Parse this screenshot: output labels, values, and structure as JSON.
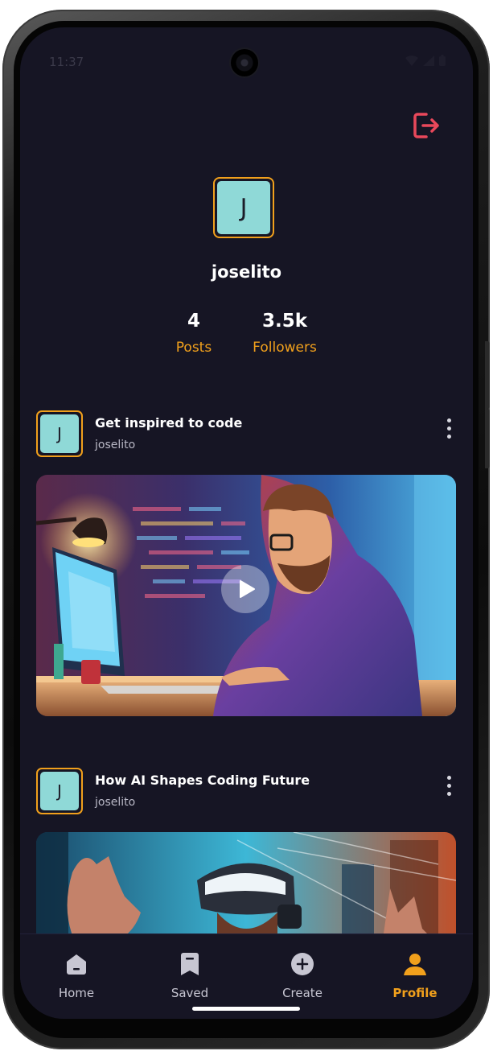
{
  "status": {
    "time": "11:37"
  },
  "profile": {
    "avatar_letter": "J",
    "username": "joselito",
    "stats": [
      {
        "value": "4",
        "label": "Posts"
      },
      {
        "value": "3.5k",
        "label": "Followers"
      }
    ]
  },
  "posts": [
    {
      "avatar_letter": "J",
      "title": "Get inspired to code",
      "author": "joselito",
      "media": "video"
    },
    {
      "avatar_letter": "J",
      "title": "How AI Shapes Coding Future",
      "author": "joselito",
      "media": "image"
    }
  ],
  "tabs": [
    {
      "label": "Home",
      "icon": "home-icon"
    },
    {
      "label": "Saved",
      "icon": "bookmark-icon"
    },
    {
      "label": "Create",
      "icon": "plus-circle-icon"
    },
    {
      "label": "Profile",
      "icon": "person-icon",
      "active": true
    }
  ],
  "colors": {
    "accent": "#f1a01c",
    "background": "#161524",
    "avatar": "#8fd9d7",
    "logout": "#e9485b"
  }
}
